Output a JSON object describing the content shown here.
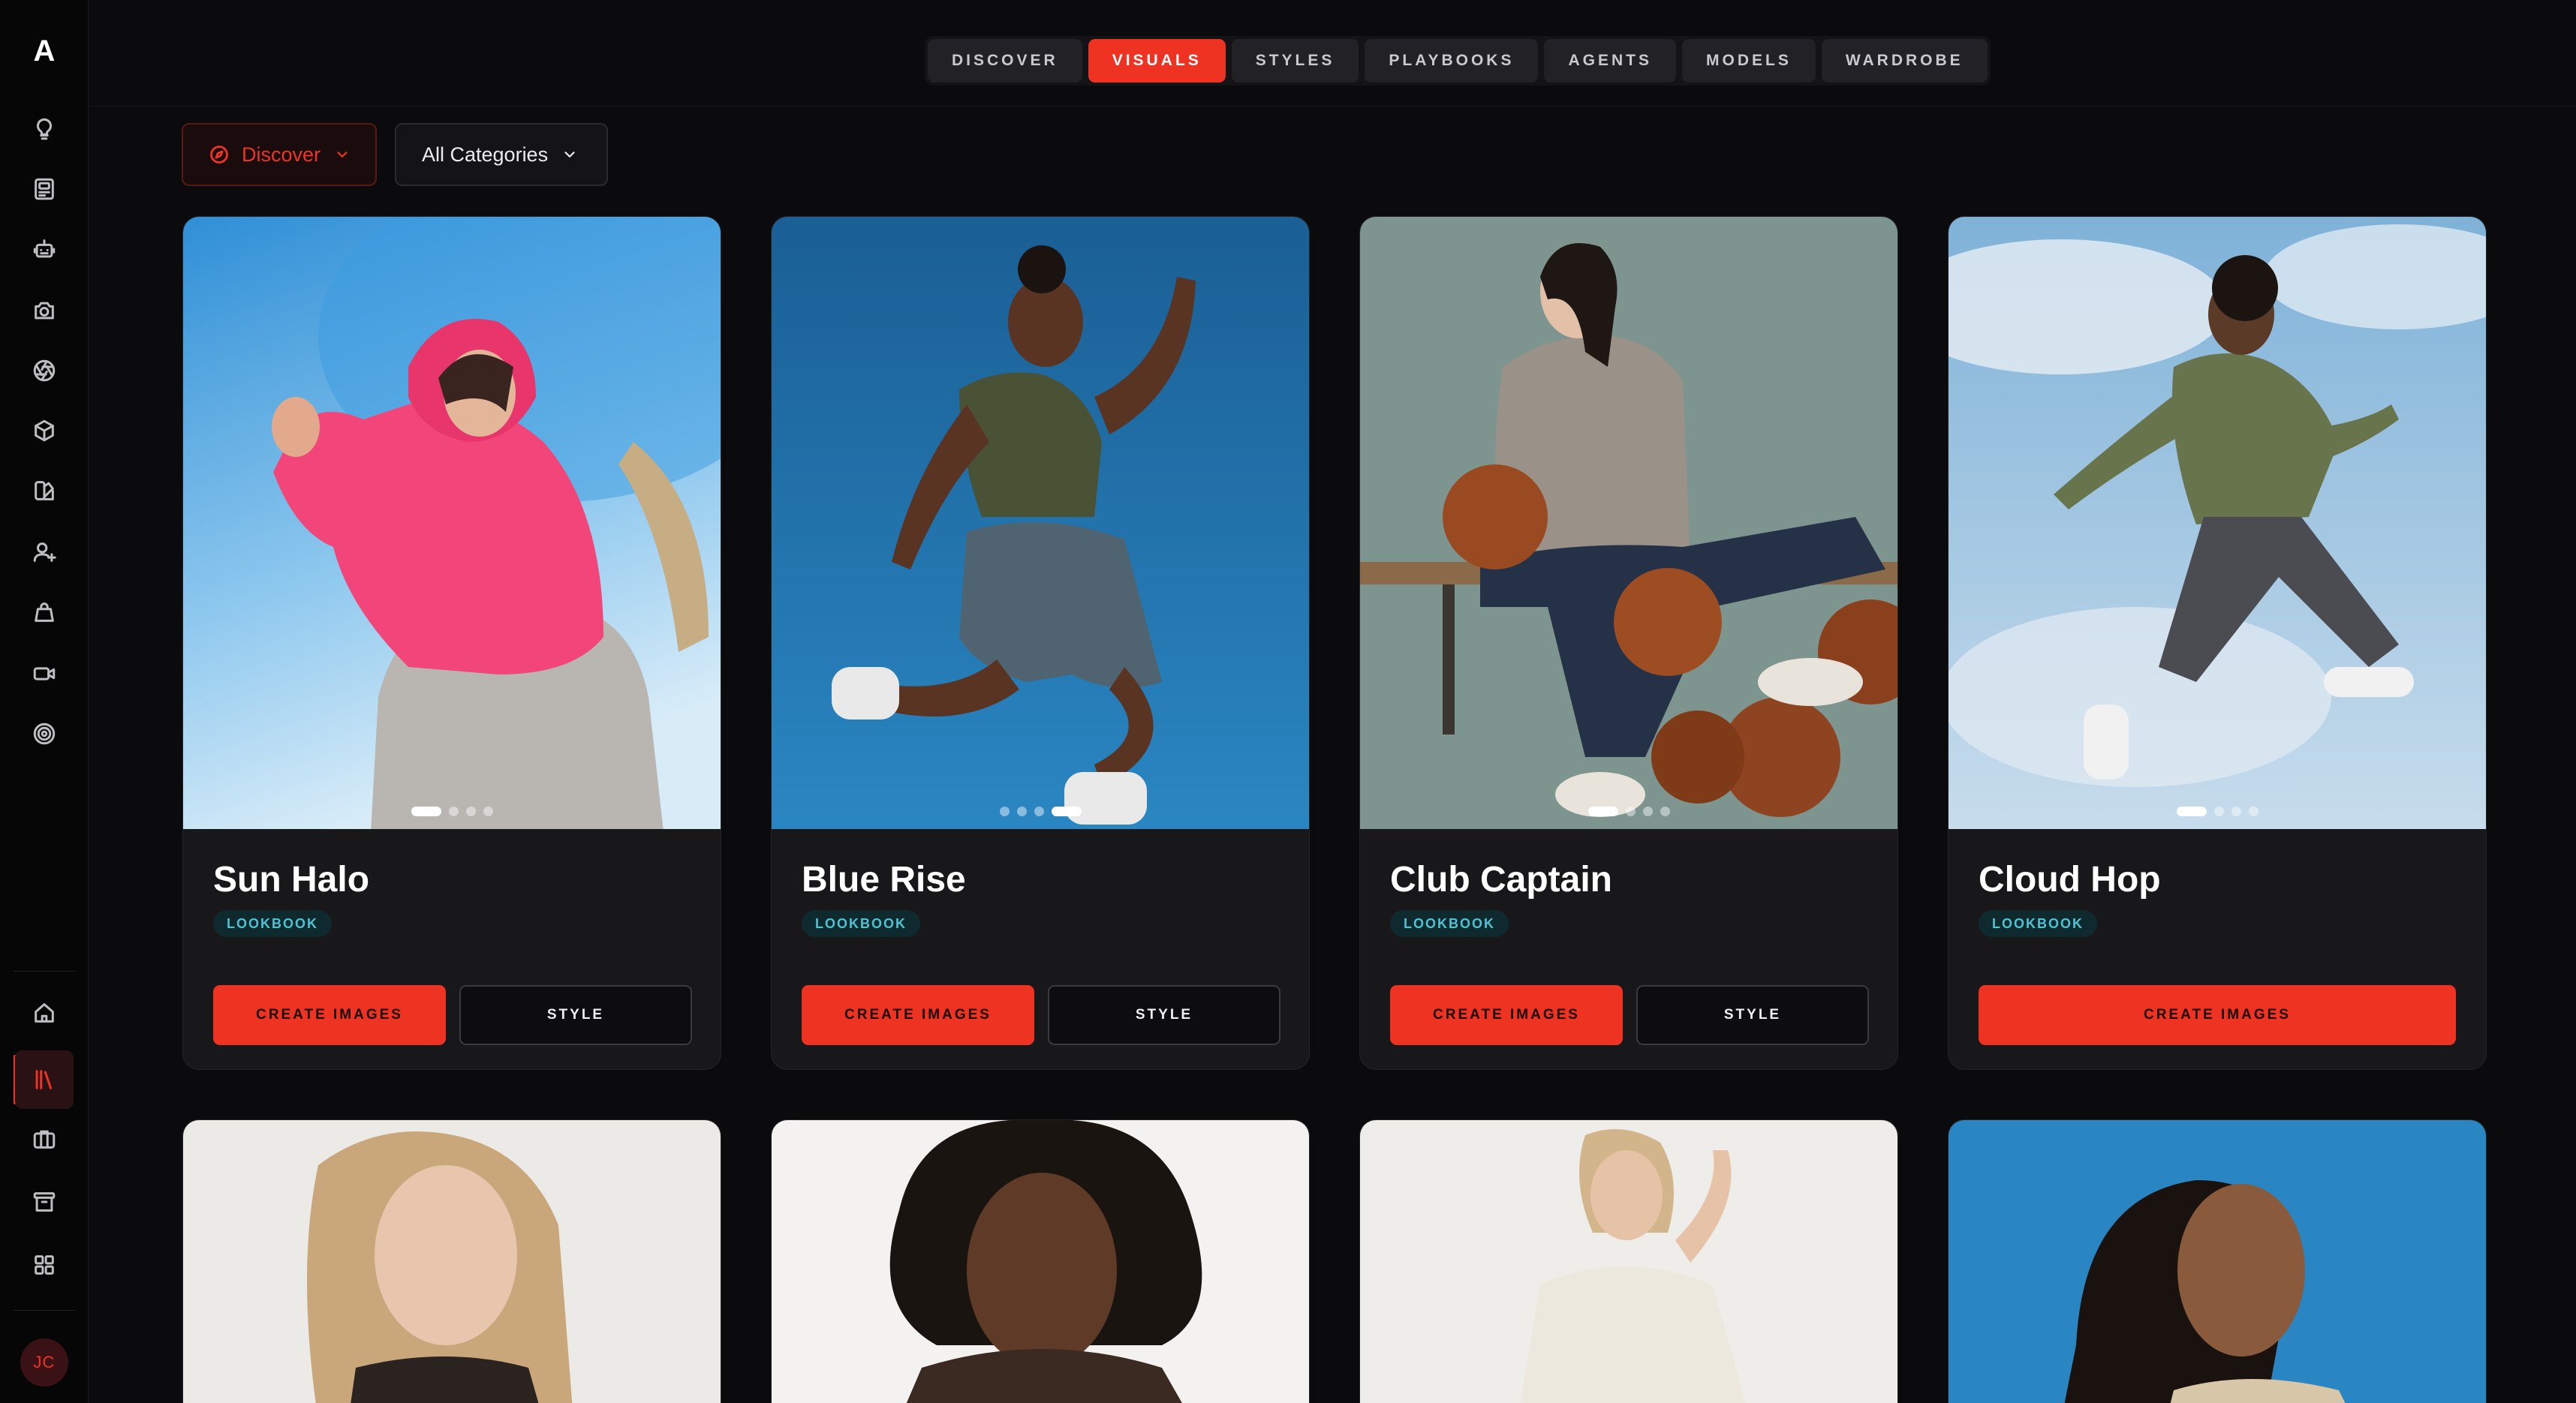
{
  "app": {
    "logo": "A",
    "user_initials": "JC"
  },
  "colors": {
    "accent": "#ee3323",
    "background": "#0b0b0d",
    "card": "#18181b",
    "badge_text": "#4fc3d1"
  },
  "sidebar": {
    "top_icons": [
      "lightbulb-icon",
      "storyboard-icon",
      "robot-icon",
      "camera-icon",
      "aperture-icon",
      "cube-icon",
      "palette-icon",
      "add-user-icon",
      "shopping-bag-icon",
      "video-icon",
      "target-icon"
    ],
    "bottom_icons": [
      "home-icon",
      "library-icon",
      "briefcase-icon",
      "archive-icon",
      "grid-icon"
    ],
    "active_item": "library-icon"
  },
  "nav": {
    "tabs": [
      "DISCOVER",
      "VISUALS",
      "STYLES",
      "PLAYBOOKS",
      "AGENTS",
      "MODELS",
      "WARDROBE"
    ],
    "active": "VISUALS"
  },
  "filters": {
    "discover_label": "Discover",
    "categories_label": "All Categories"
  },
  "cards": [
    {
      "title": "Sun Halo",
      "badge": "LOOKBOOK",
      "create_label": "CREATE IMAGES",
      "style_label": "STYLE",
      "slide_count": 4,
      "active_slide": 1
    },
    {
      "title": "Blue Rise",
      "badge": "LOOKBOOK",
      "create_label": "CREATE IMAGES",
      "style_label": "STYLE",
      "slide_count": 4,
      "active_slide": 4
    },
    {
      "title": "Club Captain",
      "badge": "LOOKBOOK",
      "create_label": "CREATE IMAGES",
      "style_label": "STYLE",
      "slide_count": 4,
      "active_slide": 1
    },
    {
      "title": "Cloud Hop",
      "badge": "LOOKBOOK",
      "create_label": "CREATE IMAGES",
      "slide_count": 4,
      "active_slide": 1
    }
  ]
}
